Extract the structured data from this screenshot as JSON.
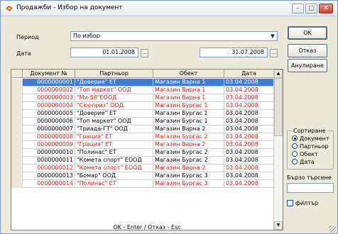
{
  "window": {
    "title": "Продажби - Избор на документ",
    "min_icon": "minimize-icon",
    "max_icon": "maximize-icon",
    "close_icon": "close-icon",
    "min_glyph": "–",
    "max_glyph": "□",
    "close_glyph": "✕"
  },
  "filter": {
    "period_label": "Период",
    "period_value": "По избор",
    "date_label": "Дата",
    "date_from": "01.01.2008",
    "date_to": "31.07.2008",
    "dots": "..."
  },
  "buttons": {
    "ok": "OK",
    "cancel": "Отказ",
    "void": "Анулиране"
  },
  "table": {
    "columns": [
      "Документ №",
      "Партньор",
      "Обект",
      "Дата"
    ],
    "rows": [
      {
        "doc": "0000000001",
        "partner": "\"Доверие\" ЕТ",
        "object": "Магазин Варна 1",
        "date": "03.04.2008",
        "red": false
      },
      {
        "doc": "0000000002",
        "partner": "\"Топ маркет\" ООД",
        "object": "Магазин Варна 1",
        "date": "03.04.2008",
        "red": true
      },
      {
        "doc": "0000000003",
        "partner": "\"Ми-58\"ЕООД",
        "object": "Магазин Варна 1",
        "date": "03.04.2008",
        "red": true
      },
      {
        "doc": "0000000004",
        "partner": "\"Сюрприз\" ООД",
        "object": "Магазин Бургас 1",
        "date": "03.04.2008",
        "red": true
      },
      {
        "doc": "0000000005",
        "partner": "\"Доверие\" ЕТ",
        "object": "Магазин Бургас 1",
        "date": "03.04.2008",
        "red": false
      },
      {
        "doc": "0000000006",
        "partner": "\"Топ маркет\" ООД",
        "object": "Магазин Бургас 1",
        "date": "03.04.2008",
        "red": false
      },
      {
        "doc": "0000000007",
        "partner": "\"Триада-ГТ\" ООД",
        "object": "Магазин Варна 2",
        "date": "03.04.2008",
        "red": false
      },
      {
        "doc": "0000000008",
        "partner": "\"Грация\" ЕТ",
        "object": "Магазин Бургас 2",
        "date": "03.04.2008",
        "red": true
      },
      {
        "doc": "0000000009",
        "partner": "\"Грация\" ЕТ",
        "object": "Магазин Варна 2",
        "date": "03.04.2008",
        "red": true
      },
      {
        "doc": "0000000010",
        "partner": "\"Полинас\" ЕТ",
        "object": "Магазин Бургас 2",
        "date": "03.04.2008",
        "red": false
      },
      {
        "doc": "0000000011",
        "partner": "\"Комета спорт\" ЕООД",
        "object": "Магазин Бургас 2",
        "date": "03.04.2008",
        "red": false
      },
      {
        "doc": "0000000012",
        "partner": "\"Комета спорт\" ЕООД",
        "object": "Магазин Варна 2",
        "date": "03.04.2008",
        "red": true
      },
      {
        "doc": "0000000013",
        "partner": "\"Бомар\" ООД",
        "object": "Магазин Бургас 3",
        "date": "03.04.2008",
        "red": false
      },
      {
        "doc": "0000000014",
        "partner": "\"Полинас\" ЕТ",
        "object": "Магазин Бургас 3",
        "date": "03.04.2008",
        "red": true
      }
    ],
    "selected_index": 0,
    "scroll_up": "▲",
    "scroll_down": "▼"
  },
  "sort": {
    "title": "Сортиране",
    "options": [
      "Документ",
      "Партньор",
      "Обект",
      "Дата"
    ],
    "selected": "Документ"
  },
  "quick_search": {
    "label": "Бързо търсене",
    "filter_label": "филтър",
    "filter_checked": false
  },
  "footer": "OK - Enter / Отказ - Esc",
  "colors": {
    "selected_row": "#3d7cd6",
    "red_row": "#d31e1e"
  }
}
